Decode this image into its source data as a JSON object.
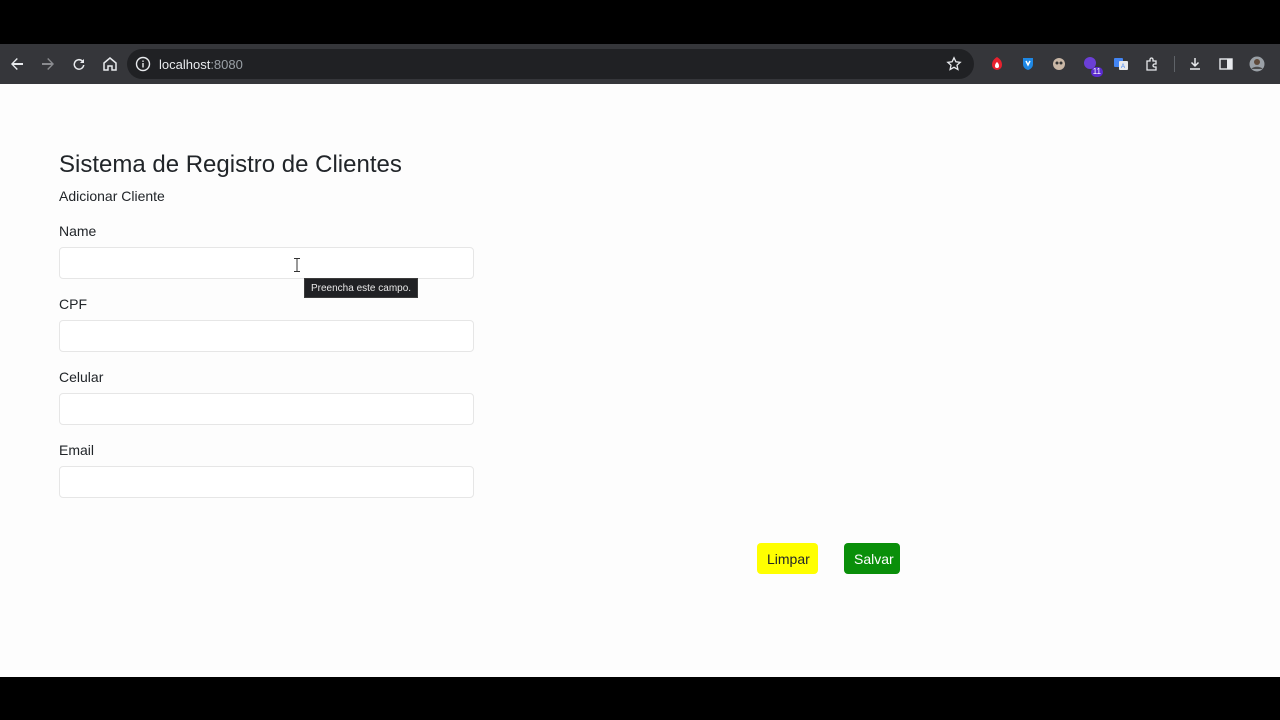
{
  "browser": {
    "url_host": "localhost",
    "url_port": ":8080",
    "extension_badge": "11"
  },
  "page": {
    "title": "Sistema de Registro de Clientes",
    "subtitle": "Adicionar Cliente",
    "fields": [
      {
        "label": "Name",
        "value": "",
        "placeholder": ""
      },
      {
        "label": "CPF",
        "value": "",
        "placeholder": ""
      },
      {
        "label": "Celular",
        "value": "",
        "placeholder": ""
      },
      {
        "label": "Email",
        "value": "",
        "placeholder": ""
      }
    ],
    "tooltip": "Preencha este campo.",
    "buttons": {
      "clear_label": "Limpar",
      "save_label": "Salvar"
    }
  },
  "colors": {
    "clear_button": "#ffff00",
    "save_button": "#0a8f0a",
    "toolbar": "#35363a"
  }
}
